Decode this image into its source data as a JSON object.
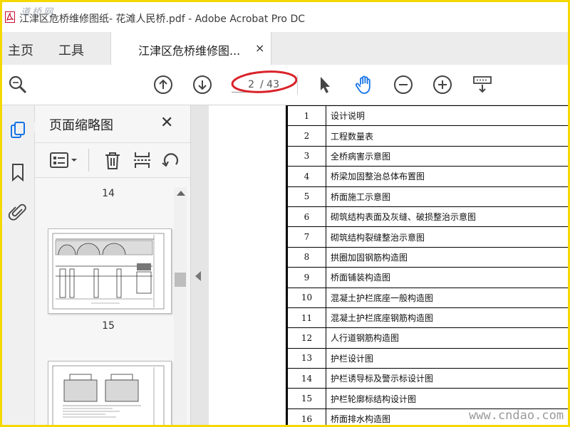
{
  "window": {
    "title": "江津区危桥维修图纸- 花滩人民桥.pdf - Adobe Acrobat Pro DC"
  },
  "tabs": {
    "home": "主页",
    "tools": "工具",
    "document": "江津区危桥维修图...",
    "close": "×"
  },
  "toolbar": {
    "page_current": "2",
    "page_total": "/ 43",
    "icons": [
      "search-icon",
      "page-up-icon",
      "page-down-icon",
      "select-arrow-icon",
      "hand-icon",
      "zoom-out-icon",
      "zoom-in-icon",
      "keyboard-icon"
    ],
    "annotation_color": "#d9232a",
    "active_icon_color": "#1473e6"
  },
  "panel": {
    "title": "页面缩略图",
    "close": "✕",
    "thumbnails": [
      "14",
      "15"
    ]
  },
  "contents": [
    {
      "n": "1",
      "name": "设计说明"
    },
    {
      "n": "2",
      "name": "工程数量表"
    },
    {
      "n": "3",
      "name": "全桥病害示意图"
    },
    {
      "n": "4",
      "name": "桥梁加固整治总体布置图"
    },
    {
      "n": "5",
      "name": "桥面施工示意图"
    },
    {
      "n": "6",
      "name": "砌筑结构表面及灰缝、破损整治示意图"
    },
    {
      "n": "7",
      "name": "砌筑结构裂缝整治示意图"
    },
    {
      "n": "8",
      "name": "拱圈加固钢筋构造图"
    },
    {
      "n": "9",
      "name": "桥面铺装构造图"
    },
    {
      "n": "10",
      "name": "混凝土护栏底座一般构造图"
    },
    {
      "n": "11",
      "name": "混凝土护栏底座钢筋构造图"
    },
    {
      "n": "12",
      "name": "人行道钢筋构造图"
    },
    {
      "n": "13",
      "name": "护栏设计图"
    },
    {
      "n": "14",
      "name": "护栏诱导标及警示标设计图"
    },
    {
      "n": "15",
      "name": "护栏轮廓标结构设计图"
    },
    {
      "n": "16",
      "name": "桥面排水构造图"
    }
  ],
  "watermarks": {
    "top_left": "道桥网",
    "bottom_right": "www.cndao.com"
  },
  "colors": {
    "frame": "#f5d800"
  }
}
